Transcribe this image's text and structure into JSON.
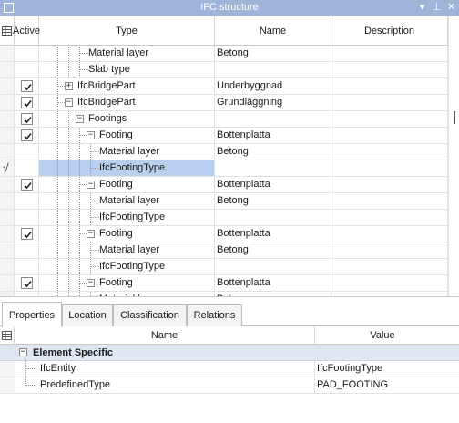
{
  "window": {
    "title": "IFC structure",
    "controls": {
      "menu": "▾",
      "pin": "⊥",
      "close": "✕"
    }
  },
  "tree": {
    "columns": {
      "active": "Active",
      "type": "Type",
      "name": "Name",
      "description": "Description"
    },
    "rows": [
      {
        "active": false,
        "indicator": "",
        "type": "Material layer",
        "name": "Betong",
        "depth": 4,
        "expander": "",
        "selected": false
      },
      {
        "active": false,
        "indicator": "",
        "type": "Slab type",
        "name": "",
        "depth": 4,
        "expander": "",
        "selected": false
      },
      {
        "active": true,
        "indicator": "",
        "type": "IfcBridgePart",
        "name": "Underbyggnad",
        "depth": 2,
        "expander": "+",
        "selected": false
      },
      {
        "active": true,
        "indicator": "",
        "type": "IfcBridgePart",
        "name": "Grundläggning",
        "depth": 2,
        "expander": "−",
        "selected": false
      },
      {
        "active": true,
        "indicator": "",
        "type": "Footings",
        "name": "",
        "depth": 3,
        "expander": "−",
        "selected": false
      },
      {
        "active": true,
        "indicator": "",
        "type": "Footing",
        "name": "Bottenplatta",
        "depth": 4,
        "expander": "−",
        "selected": false
      },
      {
        "active": false,
        "indicator": "",
        "type": "Material layer",
        "name": "Betong",
        "depth": 5,
        "expander": "",
        "selected": false
      },
      {
        "active": false,
        "indicator": "√",
        "type": "IfcFootingType",
        "name": "",
        "depth": 5,
        "expander": "",
        "selected": true
      },
      {
        "active": true,
        "indicator": "",
        "type": "Footing",
        "name": "Bottenplatta",
        "depth": 4,
        "expander": "−",
        "selected": false
      },
      {
        "active": false,
        "indicator": "",
        "type": "Material layer",
        "name": "Betong",
        "depth": 5,
        "expander": "",
        "selected": false
      },
      {
        "active": false,
        "indicator": "",
        "type": "IfcFootingType",
        "name": "",
        "depth": 5,
        "expander": "",
        "selected": false
      },
      {
        "active": true,
        "indicator": "",
        "type": "Footing",
        "name": "Bottenplatta",
        "depth": 4,
        "expander": "−",
        "selected": false
      },
      {
        "active": false,
        "indicator": "",
        "type": "Material layer",
        "name": "Betong",
        "depth": 5,
        "expander": "",
        "selected": false
      },
      {
        "active": false,
        "indicator": "",
        "type": "IfcFootingType",
        "name": "",
        "depth": 5,
        "expander": "",
        "selected": false
      },
      {
        "active": true,
        "indicator": "",
        "type": "Footing",
        "name": "Bottenplatta",
        "depth": 4,
        "expander": "−",
        "selected": false
      },
      {
        "active": false,
        "indicator": "",
        "type": "Material layer",
        "name": "Betong",
        "depth": 5,
        "expander": "",
        "selected": false
      }
    ]
  },
  "tabs": [
    {
      "label": "Properties",
      "active": true
    },
    {
      "label": "Location",
      "active": false
    },
    {
      "label": "Classification",
      "active": false
    },
    {
      "label": "Relations",
      "active": false
    }
  ],
  "properties": {
    "columns": {
      "name": "Name",
      "value": "Value"
    },
    "category": {
      "label": "Element Specific",
      "expander": "−"
    },
    "rows": [
      {
        "name": "IfcEntity",
        "value": "IfcFootingType"
      },
      {
        "name": "PredefinedType",
        "value": "PAD_FOOTING"
      }
    ]
  },
  "colors": {
    "titlebar": "#9fb4d8",
    "selection": "#b8cff0",
    "category_band": "#dfe7f3"
  },
  "icons": {
    "window": "window-icon",
    "grid_corner": "grid-corner-icon",
    "check": "checkmark-icon"
  }
}
